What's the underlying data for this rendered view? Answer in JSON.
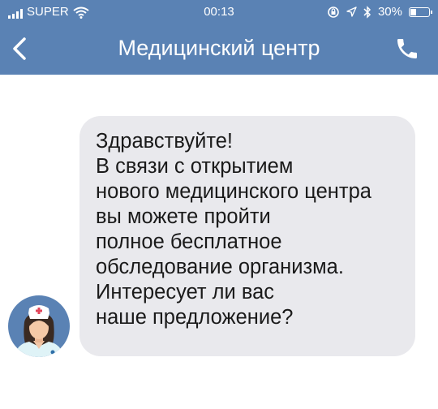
{
  "status_bar": {
    "carrier": "SUPER",
    "time": "00:13",
    "battery": "30%",
    "battery_level": 0.3,
    "icons": [
      "signal-bars-icon",
      "wifi-icon",
      "orientation-lock-icon",
      "location-icon",
      "bluetooth-icon",
      "battery-icon"
    ]
  },
  "nav": {
    "title": "Медицинский центр",
    "back_icon": "chevron-left-icon",
    "call_icon": "phone-icon"
  },
  "chat": {
    "message_lines": [
      "Здравствуйте!",
      "В связи с открытием",
      "нового медицинского центра",
      "вы можете пройти",
      "полное бесплатное",
      "обследование организма.",
      "Интересует ли вас",
      "наше предложение?"
    ],
    "avatar_icon": "nurse-avatar-icon"
  },
  "colors": {
    "header": "#5a82b4",
    "bubble": "#e9e9ed",
    "avatar_bg": "#5a82b4"
  }
}
